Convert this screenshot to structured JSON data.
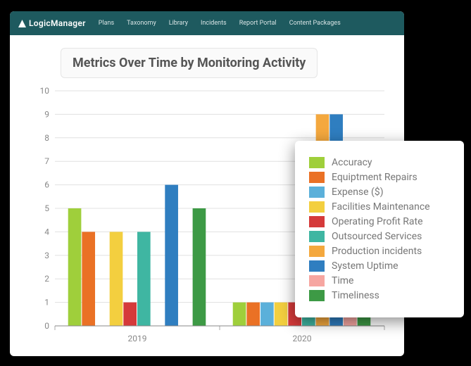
{
  "nav": {
    "brand": "LogicManager",
    "items": [
      "Plans",
      "Taxonomy",
      "Library",
      "Incidents",
      "Report Portal",
      "Content Packages"
    ]
  },
  "chart_title": "Metrics Over Time by Monitoring Activity",
  "chart_data": {
    "type": "bar",
    "title": "Metrics Over Time by Monitoring Activity",
    "xlabel": "",
    "ylabel": "",
    "ylim": [
      0,
      10
    ],
    "yticks": [
      0,
      1,
      2,
      3,
      4,
      5,
      6,
      7,
      8,
      9,
      10
    ],
    "categories": [
      "2019",
      "2020"
    ],
    "series": [
      {
        "name": "Accuracy",
        "color": "#9fcf3b",
        "values": [
          5,
          1
        ]
      },
      {
        "name": "Equiptment Repairs",
        "color": "#ea7125",
        "values": [
          4,
          1
        ]
      },
      {
        "name": "Expense ($)",
        "color": "#5bb0da",
        "values": [
          0,
          1
        ]
      },
      {
        "name": "Facilities Maintenance",
        "color": "#f3cf3f",
        "values": [
          4,
          1
        ]
      },
      {
        "name": "Operating Profit Rate",
        "color": "#d53a3a",
        "values": [
          1,
          1
        ]
      },
      {
        "name": "Outsourced Services",
        "color": "#3fb6a2",
        "values": [
          4,
          1
        ]
      },
      {
        "name": "Production incidents",
        "color": "#f4a83e",
        "values": [
          0,
          9
        ]
      },
      {
        "name": "System Uptime",
        "color": "#2f7ec0",
        "values": [
          6,
          9
        ]
      },
      {
        "name": "Time",
        "color": "#f6a6a1",
        "values": [
          0,
          1
        ]
      },
      {
        "name": "Timeliness",
        "color": "#3d9a45",
        "values": [
          5,
          1
        ]
      }
    ]
  }
}
